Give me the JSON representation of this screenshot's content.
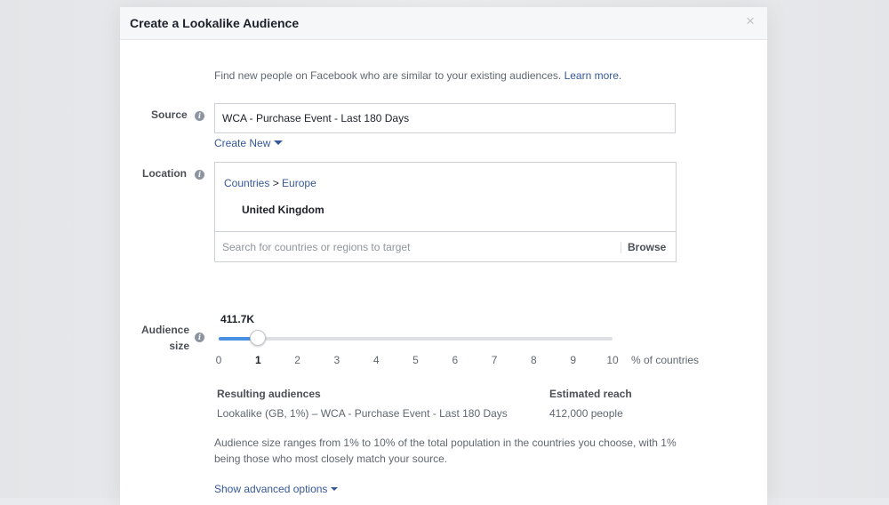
{
  "dialog": {
    "title": "Create a Lookalike Audience",
    "close_glyph": "×"
  },
  "intro": {
    "text": "Find new people on Facebook who are similar to your existing audiences.",
    "link": "Learn more."
  },
  "source": {
    "label": "Source",
    "value": "WCA - Purchase Event - Last 180 Days",
    "create_new": "Create New"
  },
  "location": {
    "label": "Location",
    "breadcrumb_root": "Countries",
    "breadcrumb_sep": " > ",
    "breadcrumb_region": "Europe",
    "selected_country": "United Kingdom",
    "search_placeholder": "Search for countries or regions to target",
    "browse_label": "Browse"
  },
  "audience_size": {
    "label_line1": "Audience",
    "label_line2": "size",
    "reach": "411.7K",
    "selected_percent": 1,
    "min": 0,
    "max": 10,
    "ticks": [
      "0",
      "1",
      "2",
      "3",
      "4",
      "5",
      "6",
      "7",
      "8",
      "9",
      "10"
    ],
    "unit": "% of countries"
  },
  "results": {
    "resulting_header": "Resulting audiences",
    "resulting_value": "Lookalike (GB, 1%) – WCA - Purchase Event - Last 180 Days",
    "reach_header": "Estimated reach",
    "reach_value": "412,000 people"
  },
  "note": "Audience size ranges from 1% to 10% of the total population in the countries you choose, with 1% being those who most closely match your source.",
  "advanced_options": "Show advanced options",
  "icons": {
    "info": "info-icon",
    "close": "close-icon",
    "caret": "caret-down-icon"
  },
  "colors": {
    "link": "#365899",
    "slider_fill": "#4a90e2",
    "header_bg": "#f6f7f9"
  }
}
